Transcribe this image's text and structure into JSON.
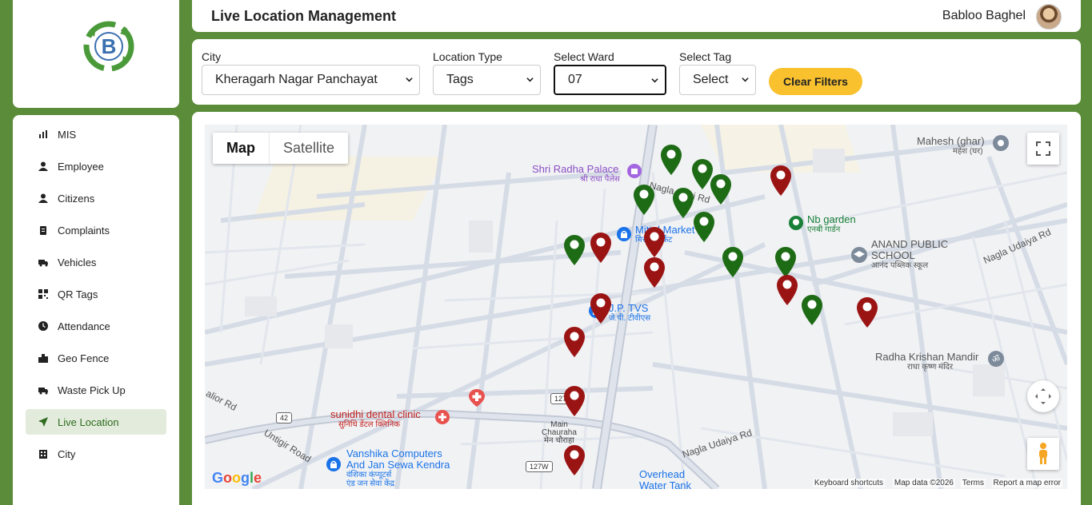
{
  "header": {
    "title": "Live Location Management",
    "user_name": "Babloo Baghel"
  },
  "nav": [
    {
      "label": "MIS",
      "icon": "chart-icon"
    },
    {
      "label": "Employee",
      "icon": "user-icon"
    },
    {
      "label": "Citizens",
      "icon": "user-icon"
    },
    {
      "label": "Complaints",
      "icon": "clipboard-icon"
    },
    {
      "label": "Vehicles",
      "icon": "truck-icon"
    },
    {
      "label": "QR Tags",
      "icon": "qr-icon"
    },
    {
      "label": "Attendance",
      "icon": "clock-icon"
    },
    {
      "label": "Geo Fence",
      "icon": "city-icon"
    },
    {
      "label": "Waste Pick Up",
      "icon": "truck-icon"
    },
    {
      "label": "Live Location",
      "icon": "location-arrow-icon",
      "active": true
    },
    {
      "label": "City",
      "icon": "building-icon"
    }
  ],
  "filters": {
    "city": {
      "label": "City",
      "value": "Kheragarh Nagar Panchayat"
    },
    "location_type": {
      "label": "Location Type",
      "value": "Tags"
    },
    "ward": {
      "label": "Select Ward",
      "value": "07"
    },
    "tag": {
      "label": "Select Tag",
      "value": "Select"
    },
    "clear_label": "Clear Filters"
  },
  "map": {
    "type_map": "Map",
    "type_satellite": "Satellite",
    "places": {
      "radha_palace": {
        "name": "Shri Radha Palace",
        "local": "श्री राधा पैलेस"
      },
      "mittal_market": {
        "name": "Mittal Market",
        "local": "मित्तल मार्केट"
      },
      "nb_garden": {
        "name": "Nb garden",
        "local": "एनबी गार्डन"
      },
      "anand_school_1": "ANAND PUBLIC",
      "anand_school_2": "SCHOOL",
      "anand_school_local": "आनंद पब्लिक स्कूल",
      "mahesh": {
        "name": "Mahesh (ghar)",
        "local": "महेश (घर)"
      },
      "jp_tvs": {
        "name": "J.P. TVS",
        "local": "जे.पी. टीवीएस"
      },
      "radha_krishan": {
        "name": "Radha Krishan Mandir",
        "local": "राधा कृष्ण मंदिर"
      },
      "sunidhi": {
        "name": "sunidhi dental clinic",
        "local": "सुनिधि डेंटल क्लिनिक"
      },
      "main_chauraha_1": "Main",
      "main_chauraha_2": "Chauraha",
      "main_chauraha_local": "मेन चौराहा",
      "vanshika_1": "Vanshika Computers",
      "vanshika_2": "And Jan Sewa Kendra",
      "vanshika_local_1": "वंशिका कंप्यूटर्स",
      "vanshika_local_2": "एंड जन सेवा केंद्र",
      "overhead_1": "Overhead",
      "overhead_2": "Water Tank"
    },
    "roads": {
      "nagla_deyi": "Nagla Deyi Rd",
      "nagla_udaiya_1": "Nagla Udaiya Rd",
      "nagla_udaiya_2": "Nagla Udaiya Rd",
      "untigir": "Untigir Road",
      "nalior": "alior Rd",
      "r127_1": "127W",
      "r127_2": "127W",
      "r42": "42"
    },
    "google": "Google",
    "attribution": {
      "shortcuts": "Keyboard shortcuts",
      "data": "Map data ©2026",
      "terms": "Terms",
      "report": "Report a map error"
    },
    "pin_colors": {
      "green": "#1e6b16",
      "red": "#9b1414"
    }
  }
}
